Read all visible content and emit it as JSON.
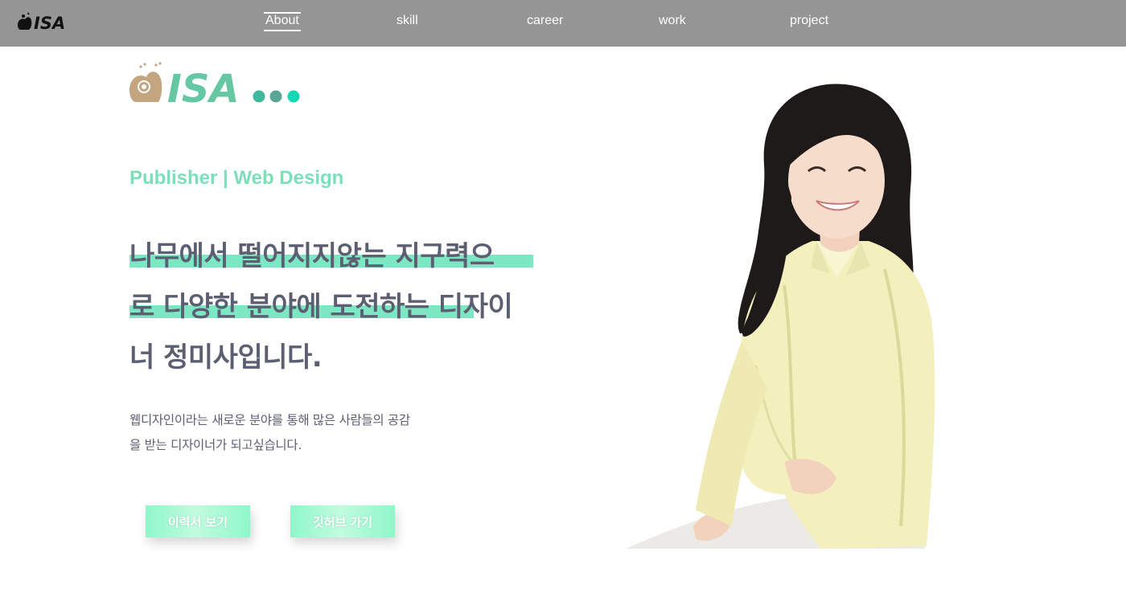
{
  "header": {
    "logo_text": "ISA",
    "nav": [
      {
        "label": "About",
        "active": true
      },
      {
        "label": "skill",
        "active": false
      },
      {
        "label": "career",
        "active": false
      },
      {
        "label": "work",
        "active": false
      },
      {
        "label": "project",
        "active": false
      }
    ]
  },
  "hero": {
    "logo_text": "ISA",
    "subtitle": "Publisher | Web Design",
    "headline_lines": [
      "나무에서 떨어지지않는 지구력으",
      "로 다양한 분야에 도전하는 디자이",
      "너 정미사입니다."
    ],
    "description_lines": [
      "웹디자인이라는 새로운 분야를 통해 많은 사람들의 공감",
      "을 받는 디자이너가 되고싶습니다."
    ],
    "buttons": {
      "resume": "이력서 보기",
      "github": "깃허브 가기"
    }
  },
  "colors": {
    "nav_bg": "#959595",
    "accent_mint": "#7de7c4",
    "subtitle": "#7ddfb7",
    "text_dark": "#5c5f72",
    "logo_brown": "#c3a57f",
    "logo_teal": "#66c7a3"
  },
  "icons": [
    "squirrel-logo-icon",
    "squirrel-logo-large-icon",
    "portrait-photo"
  ]
}
